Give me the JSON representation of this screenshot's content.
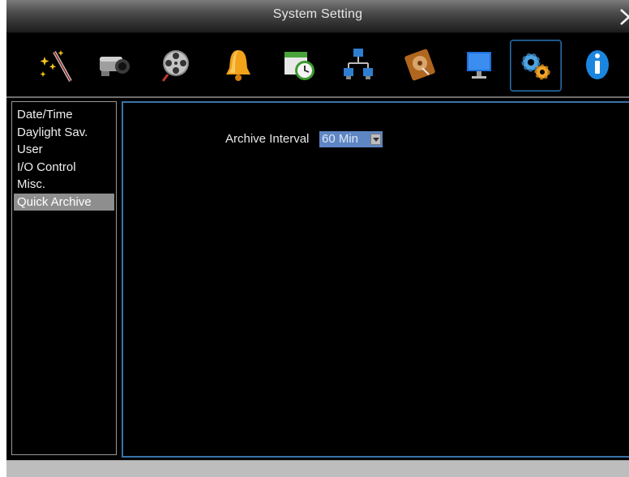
{
  "window": {
    "title": "System Setting"
  },
  "toolbar": {
    "icons": [
      {
        "name": "wizard-wand-icon"
      },
      {
        "name": "camera-icon"
      },
      {
        "name": "film-reel-icon"
      },
      {
        "name": "alarm-bell-icon"
      },
      {
        "name": "schedule-clock-icon"
      },
      {
        "name": "network-icon"
      },
      {
        "name": "hard-disk-icon"
      },
      {
        "name": "monitor-icon"
      },
      {
        "name": "system-gears-icon",
        "active": true
      },
      {
        "name": "info-icon"
      }
    ]
  },
  "sidebar": {
    "items": [
      {
        "label": "Date/Time"
      },
      {
        "label": "Daylight Sav."
      },
      {
        "label": "User"
      },
      {
        "label": "I/O Control"
      },
      {
        "label": "Misc."
      },
      {
        "label": "Quick Archive",
        "selected": true
      }
    ]
  },
  "content": {
    "archive_interval_label": "Archive Interval",
    "archive_interval_value": "60 Min"
  },
  "colors": {
    "selected_item": "#8e8e8e",
    "panel_border": "#3973a7",
    "select_background": "#5e86c4"
  }
}
